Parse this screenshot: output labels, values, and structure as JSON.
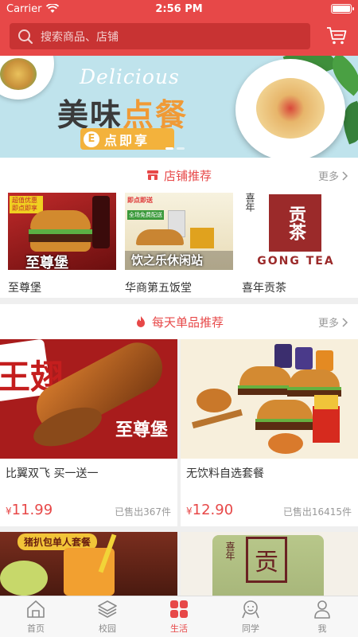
{
  "status": {
    "carrier": "Carrier",
    "time": "2:56 PM"
  },
  "search": {
    "placeholder": "搜索商品、店铺"
  },
  "banner": {
    "script": "Delicious",
    "title_a": "美味",
    "title_b": "点餐",
    "pill_icon": "E",
    "pill_text": "点即享"
  },
  "shop_section": {
    "title": "店铺推荐",
    "more": "更多"
  },
  "shops": [
    {
      "name": "至尊堡",
      "img_text": "至尊堡",
      "tag": "超值优惠 即点即享"
    },
    {
      "name": "华商第五饭堂",
      "img_text": "饮之乐休闲站",
      "tag": "即点即送",
      "tag2": "全场免费配送"
    },
    {
      "name": "喜年贡茶",
      "img_text": "GONG TEA",
      "logo_char": "贡茶",
      "logo_top": "喜年"
    }
  ],
  "product_section": {
    "title": "每天单品推荐",
    "more": "更多",
    "hot": "HOT"
  },
  "products": [
    {
      "title": "比翼双飞 买一送一",
      "price": "11.99",
      "currency": "¥",
      "sold": "已售出367件",
      "img_text": "至尊堡",
      "img_big": "王翅"
    },
    {
      "title": "无饮料自选套餐",
      "price": "12.90",
      "currency": "¥",
      "sold": "已售出16415件"
    },
    {
      "img_text": "猪扒包单人套餐"
    },
    {
      "img_text": "喜年",
      "img_big": "贡"
    }
  ],
  "tabs": [
    {
      "label": "首页",
      "icon": "home-icon"
    },
    {
      "label": "校园",
      "icon": "layers-icon"
    },
    {
      "label": "生活",
      "icon": "grid-icon",
      "active": true
    },
    {
      "label": "同学",
      "icon": "classmates-icon"
    },
    {
      "label": "我",
      "icon": "person-icon"
    }
  ],
  "colors": {
    "accent": "#e74848",
    "search_bg": "#c83333",
    "banner_bg": "#bfe3ec",
    "pill": "#f3b23c"
  }
}
